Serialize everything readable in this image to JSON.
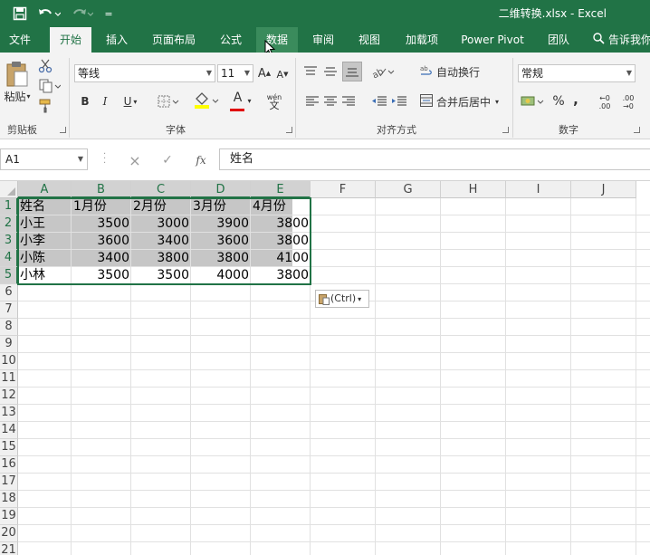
{
  "window": {
    "title": "二维转换.xlsx - Excel"
  },
  "quick_access": {
    "more": "="
  },
  "tabs": [
    "文件",
    "开始",
    "插入",
    "页面布局",
    "公式",
    "数据",
    "审阅",
    "视图",
    "加载项",
    "Power Pivot",
    "团队"
  ],
  "tell_me": "告诉我你",
  "ribbon": {
    "clipboard": {
      "label": "剪贴板",
      "paste": "粘贴"
    },
    "font": {
      "label": "字体",
      "name": "等线",
      "size": "11",
      "grow": "A",
      "shrink": "A",
      "bold": "B",
      "italic": "I",
      "underline": "U",
      "phonetic": "wén",
      "font_color": "A"
    },
    "alignment": {
      "label": "对齐方式",
      "wrap_text": "自动换行",
      "merge_center": "合并后居中"
    },
    "number": {
      "label": "数字",
      "format": "常规",
      "percent": "%",
      "comma": ",",
      "inc_decimal": ".00",
      "dec_decimal": ".00"
    }
  },
  "formula_bar": {
    "name_box": "A1",
    "cancel": "×",
    "enter": "✓",
    "fx": "fx",
    "value": "姓名"
  },
  "columns": [
    "A",
    "B",
    "C",
    "D",
    "E",
    "F",
    "G",
    "H",
    "I",
    "J"
  ],
  "rows": [
    "1",
    "2",
    "3",
    "4",
    "5",
    "6",
    "7",
    "8",
    "9",
    "10",
    "11",
    "12",
    "13",
    "14",
    "15",
    "16",
    "17",
    "18",
    "19",
    "20",
    "21"
  ],
  "table": {
    "header": [
      "姓名",
      "1月份",
      "2月份",
      "3月份",
      "4月份"
    ],
    "rows": [
      [
        "小王",
        "3500",
        "3000",
        "3900",
        "3800"
      ],
      [
        "小李",
        "3600",
        "3400",
        "3600",
        "3800"
      ],
      [
        "小陈",
        "3400",
        "3800",
        "3800",
        "4100"
      ],
      [
        "小林",
        "3500",
        "3500",
        "4000",
        "3800"
      ]
    ]
  },
  "paste_options": {
    "label": "(Ctrl)"
  },
  "colors": {
    "accent": "#217346",
    "selection_fill": "#c6c6c6"
  }
}
